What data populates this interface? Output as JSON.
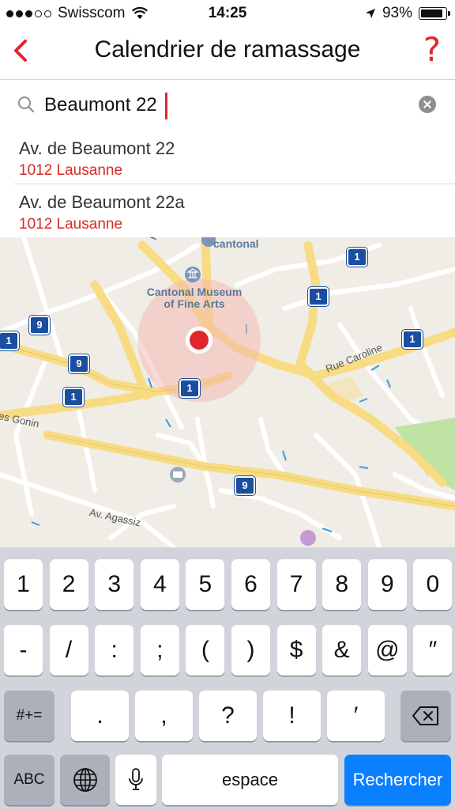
{
  "status": {
    "carrier": "Swisscom",
    "time": "14:25",
    "battery_percent": "93%",
    "battery_level": 0.93
  },
  "nav": {
    "title": "Calendrier de ramassage",
    "help_label": "?"
  },
  "search": {
    "value": "Beaumont 22"
  },
  "results": [
    {
      "street": "Av. de Beaumont 22",
      "city": "1012 Lausanne"
    },
    {
      "street": "Av. de Beaumont 22a",
      "city": "1012 Lausanne"
    }
  ],
  "map": {
    "poi_museum": "Cantonal Museum\nof Fine Arts",
    "poi_cantonal": "cantonal",
    "road_caroline": "Rue Caroline",
    "road_gonin": "es Gonin",
    "road_agassiz": "Av. Agassiz",
    "road_partial": "R",
    "bus_lines": [
      "1",
      "1",
      "1",
      "9",
      "9",
      "1",
      "1",
      "9",
      "1"
    ],
    "accent_color": "#e0262c"
  },
  "keyboard": {
    "row1": [
      "1",
      "2",
      "3",
      "4",
      "5",
      "6",
      "7",
      "8",
      "9",
      "0"
    ],
    "row2": [
      "-",
      "/",
      ":",
      ";",
      "(",
      ")",
      "$",
      "&",
      "@",
      "″"
    ],
    "row3_left": "#+=",
    "row3": [
      ".",
      ",",
      "?",
      "!",
      "′"
    ],
    "row4": {
      "abc": "ABC",
      "space": "espace",
      "search": "Rechercher"
    }
  }
}
